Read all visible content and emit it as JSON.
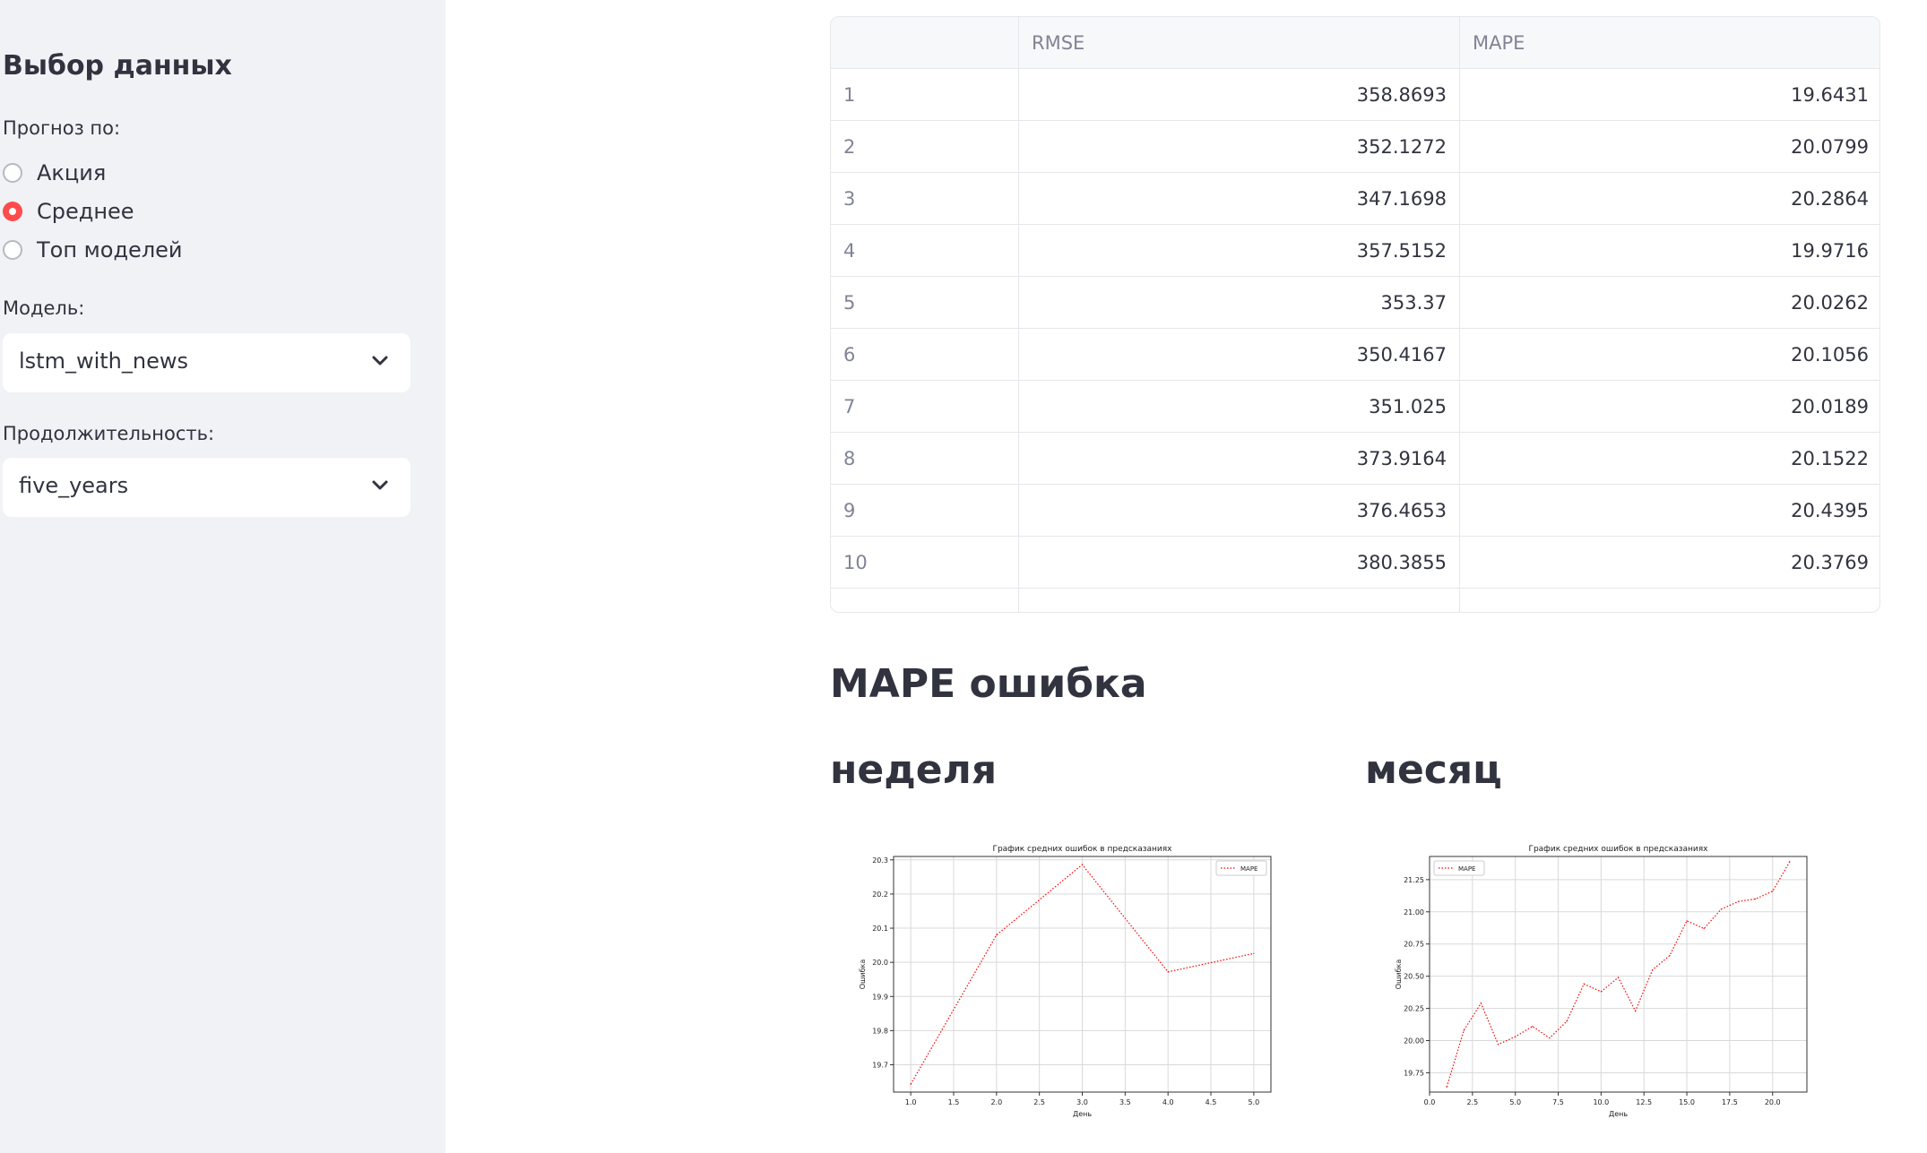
{
  "sidebar": {
    "title": "Выбор данных",
    "forecast_label": "Прогноз по:",
    "forecast_options": [
      {
        "label": "Акция",
        "selected": false
      },
      {
        "label": "Среднее",
        "selected": true
      },
      {
        "label": "Топ моделей",
        "selected": false
      }
    ],
    "model_label": "Модель:",
    "model_value": "lstm_with_news",
    "duration_label": "Продолжительность:",
    "duration_value": "five_years"
  },
  "table": {
    "columns": [
      "",
      "RMSE",
      "MAPE"
    ],
    "rows": [
      {
        "idx": "1",
        "rmse": "358.8693",
        "mape": "19.6431"
      },
      {
        "idx": "2",
        "rmse": "352.1272",
        "mape": "20.0799"
      },
      {
        "idx": "3",
        "rmse": "347.1698",
        "mape": "20.2864"
      },
      {
        "idx": "4",
        "rmse": "357.5152",
        "mape": "19.9716"
      },
      {
        "idx": "5",
        "rmse": "353.37",
        "mape": "20.0262"
      },
      {
        "idx": "6",
        "rmse": "350.4167",
        "mape": "20.1056"
      },
      {
        "idx": "7",
        "rmse": "351.025",
        "mape": "20.0189"
      },
      {
        "idx": "8",
        "rmse": "373.9164",
        "mape": "20.1522"
      },
      {
        "idx": "9",
        "rmse": "376.4653",
        "mape": "20.4395"
      },
      {
        "idx": "10",
        "rmse": "380.3855",
        "mape": "20.3769"
      }
    ]
  },
  "main": {
    "subtitle": "MAPE ошибка",
    "week_heading": "неделя",
    "month_heading": "месяц"
  },
  "colors": {
    "accent": "#ff4b4b",
    "line": "#ff0000",
    "sidebar_bg": "#f0f2f6"
  },
  "chart_data": [
    {
      "type": "line",
      "title": "График средних ошибок в предсказаниях",
      "xlabel": "День",
      "ylabel": "Ошибка",
      "legend": "MAPE",
      "legend_position": "top-right",
      "grid": true,
      "xlim": [
        0.8,
        5.2
      ],
      "ylim": [
        19.62,
        20.31
      ],
      "xticks": [
        "1.0",
        "1.5",
        "2.0",
        "2.5",
        "3.0",
        "3.5",
        "4.0",
        "4.5",
        "5.0"
      ],
      "yticks": [
        "19.7",
        "19.8",
        "19.9",
        "20.0",
        "20.1",
        "20.2",
        "20.3"
      ],
      "series": [
        {
          "name": "MAPE",
          "x": [
            1,
            2,
            3,
            4,
            5
          ],
          "y": [
            19.643,
            20.08,
            20.286,
            19.972,
            20.026
          ]
        }
      ]
    },
    {
      "type": "line",
      "title": "График средних ошибок в предсказаниях",
      "xlabel": "День",
      "ylabel": "Ошибка",
      "legend": "MAPE",
      "legend_position": "top-left",
      "grid": true,
      "xlim": [
        0,
        22
      ],
      "ylim": [
        19.6,
        21.43
      ],
      "xticks": [
        "0.0",
        "2.5",
        "5.0",
        "7.5",
        "10.0",
        "12.5",
        "15.0",
        "17.5",
        "20.0"
      ],
      "yticks": [
        "19.75",
        "20.00",
        "20.25",
        "20.50",
        "20.75",
        "21.00",
        "21.25"
      ],
      "series": [
        {
          "name": "MAPE",
          "x": [
            1,
            2,
            3,
            4,
            5,
            6,
            7,
            8,
            9,
            10,
            11,
            12,
            13,
            14,
            15,
            16,
            17,
            18,
            19,
            20,
            21
          ],
          "y": [
            19.64,
            20.08,
            20.29,
            19.97,
            20.03,
            20.11,
            20.02,
            20.15,
            20.44,
            20.38,
            20.49,
            20.23,
            20.55,
            20.66,
            20.93,
            20.87,
            21.02,
            21.08,
            21.1,
            21.16,
            21.39
          ]
        }
      ]
    }
  ]
}
